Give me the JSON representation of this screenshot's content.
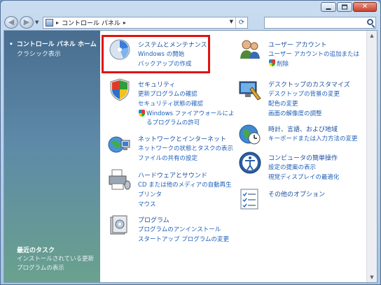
{
  "address": {
    "path": "コントロール パネル",
    "search_placeholder": ""
  },
  "titlebar": {
    "minimize": "",
    "maximize": "",
    "close": "✕"
  },
  "sidebar": {
    "home": "コントロール パネル ホーム",
    "classic": "クラシック表示",
    "recent_title": "最近のタスク",
    "recent_items": [
      "インストールされている更新プログラムの表示"
    ]
  },
  "categories": {
    "system": {
      "title": "システムとメンテナンス",
      "links": [
        "Windows の開始",
        "バックアップの作成"
      ]
    },
    "security": {
      "title": "セキュリティ",
      "links": [
        "更新プログラムの確認",
        "セキュリティ状態の確認",
        "Windows ファイアウォールによ",
        "るプログラムの許可"
      ]
    },
    "network": {
      "title": "ネットワークとインターネット",
      "links": [
        "ネットワークの状態とタスクの表示",
        "ファイルの共有の設定"
      ]
    },
    "hardware": {
      "title": "ハードウェアとサウンド",
      "links": [
        "CD または他のメディアの自動再生",
        "プリンタ",
        "マウス"
      ]
    },
    "programs": {
      "title": "プログラム",
      "links": [
        "プログラムのアンインストール",
        "スタートアップ プログラムの変更"
      ]
    },
    "user": {
      "title": "ユーザー アカウント",
      "links": [
        "ユーザー アカウントの追加または",
        "削除"
      ]
    },
    "desktop": {
      "title": "デスクトップのカスタマイズ",
      "links": [
        "デスクトップの背景の変更",
        "配色の変更",
        "画面の解像度の調整"
      ]
    },
    "clock": {
      "title": "時計、言語、および地域",
      "links": [
        "キーボードまたは入力方法の変更"
      ]
    },
    "access": {
      "title": "コンピュータの簡単操作",
      "links": [
        "設定の提案の表示",
        "視覚ディスプレイの最適化"
      ]
    },
    "other": {
      "title": "その他のオプション",
      "links": []
    }
  },
  "colors": {
    "link": "#1e5fb8",
    "title": "#1a4f9c",
    "highlight": "#e0120f"
  }
}
